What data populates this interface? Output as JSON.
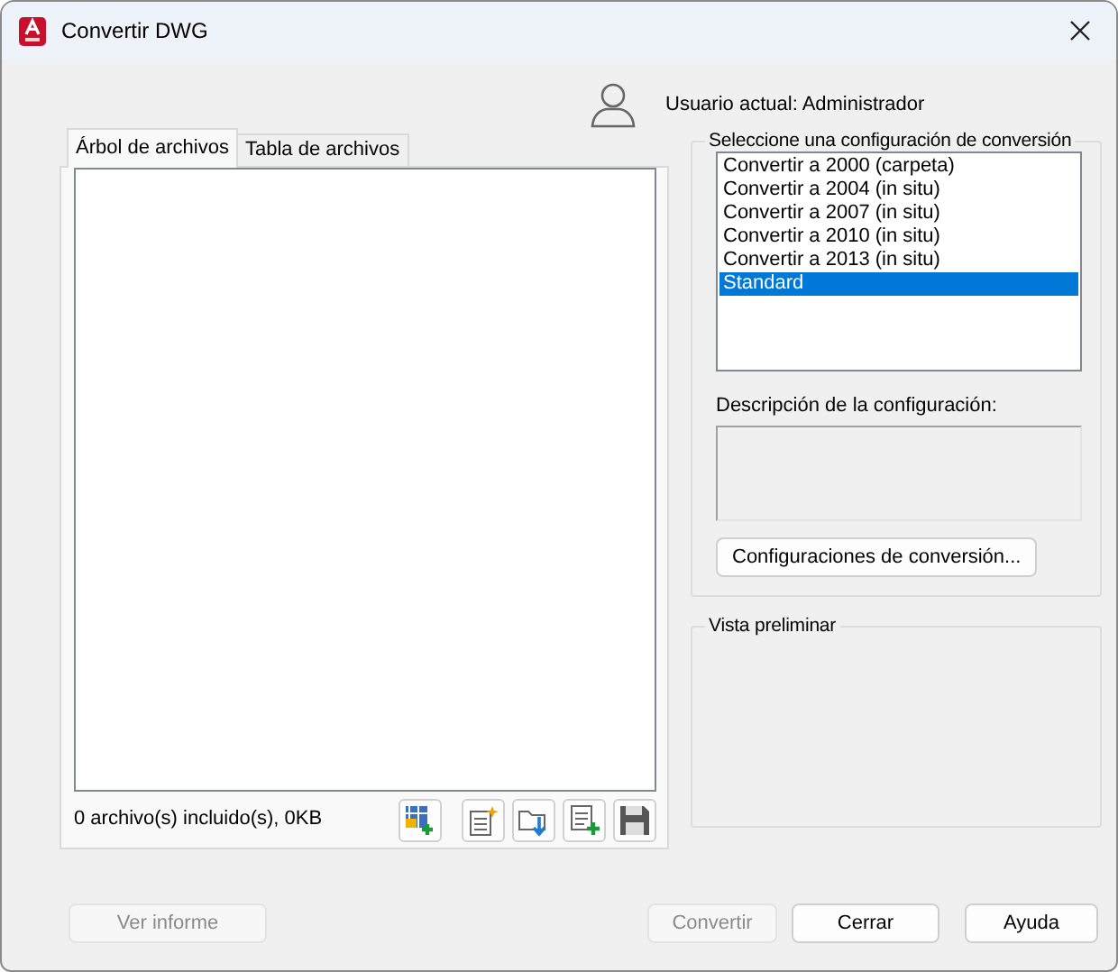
{
  "window": {
    "title": "Convertir DWG"
  },
  "user": {
    "label": "Usuario actual: Administrador"
  },
  "tabs": [
    {
      "label": "Árbol de archivos",
      "selected": true
    },
    {
      "label": "Tabla de archivos",
      "selected": false
    }
  ],
  "status": "0 archivo(s) incluido(s), 0KB",
  "setups": {
    "title": "Seleccione una configuración de conversión",
    "items": [
      {
        "label": "Convertir a 2000 (carpeta)",
        "selected": false
      },
      {
        "label": "Convertir a 2004 (in situ)",
        "selected": false
      },
      {
        "label": "Convertir a 2007 (in situ)",
        "selected": false
      },
      {
        "label": "Convertir a 2010 (in situ)",
        "selected": false
      },
      {
        "label": "Convertir a 2013 (in situ)",
        "selected": false
      },
      {
        "label": "Standard",
        "selected": true
      }
    ],
    "description_label": "Descripción de la configuración:",
    "button": {
      "label": "Configuraciones de conversión...",
      "disabled": false
    }
  },
  "preview": {
    "title": "Vista preliminar"
  },
  "buttons": [
    {
      "label": "Ver informe",
      "disabled": true
    },
    {
      "label": "Convertir",
      "disabled": true
    },
    {
      "label": "Cerrar",
      "disabled": false
    },
    {
      "label": "Ayuda",
      "disabled": false
    }
  ]
}
